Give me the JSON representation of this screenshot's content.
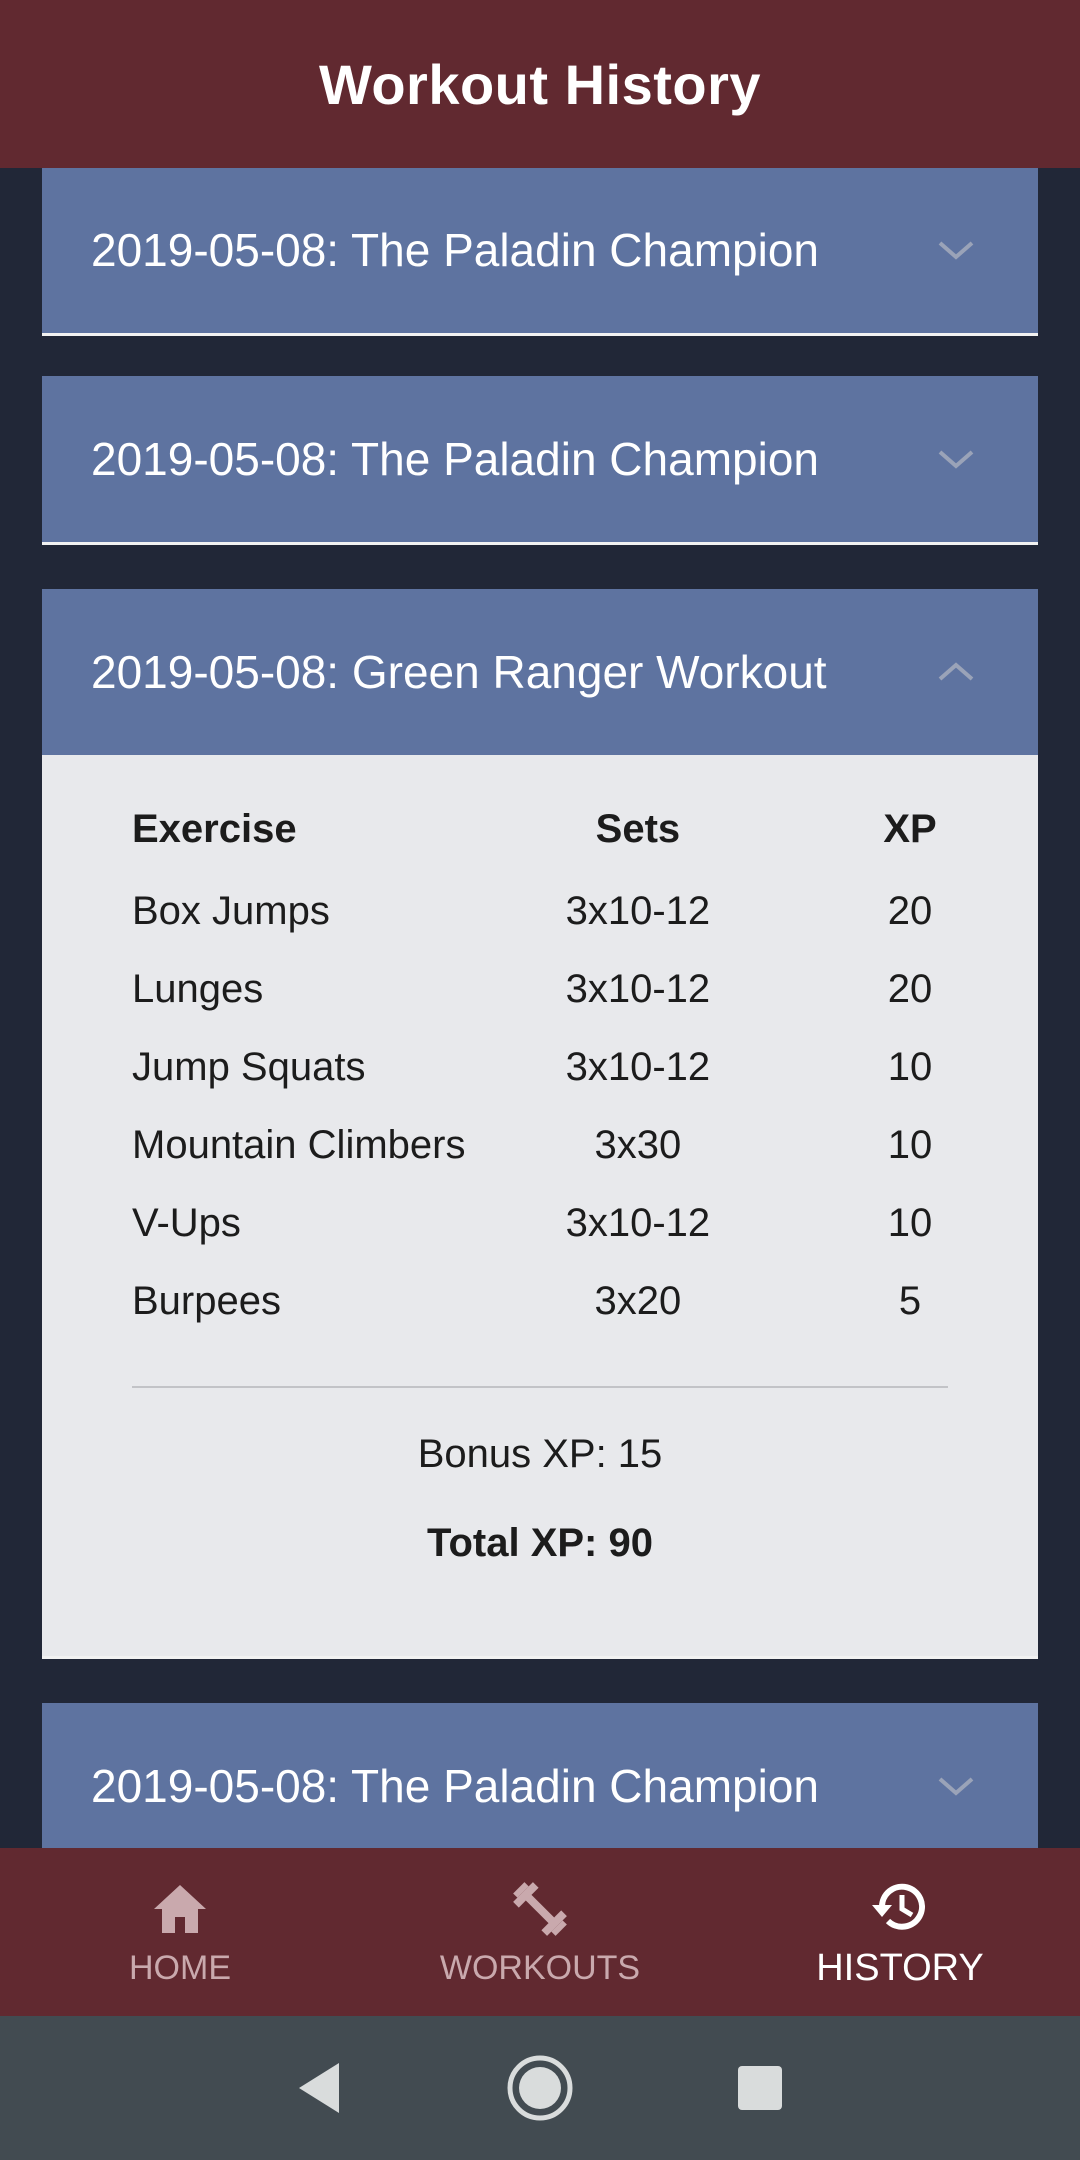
{
  "header": {
    "title": "Workout History"
  },
  "history": {
    "panels": [
      {
        "title": "2019-05-08: The Paladin Champion",
        "expanded": false
      },
      {
        "title": "2019-05-08: The Paladin Champion",
        "expanded": false
      },
      {
        "title": "2019-05-08: Green Ranger Workout",
        "expanded": true,
        "columns": [
          "Exercise",
          "Sets",
          "XP"
        ],
        "rows": [
          {
            "exercise": "Box Jumps",
            "sets": "3x10-12",
            "xp": "20"
          },
          {
            "exercise": "Lunges",
            "sets": "3x10-12",
            "xp": "20"
          },
          {
            "exercise": "Jump Squats",
            "sets": "3x10-12",
            "xp": "10"
          },
          {
            "exercise": "Mountain Climbers",
            "sets": "3x30",
            "xp": "10"
          },
          {
            "exercise": "V-Ups",
            "sets": "3x10-12",
            "xp": "10"
          },
          {
            "exercise": "Burpees",
            "sets": "3x20",
            "xp": "5"
          }
        ],
        "bonus": "Bonus XP: 15",
        "total": "Total XP: 90"
      },
      {
        "title": "2019-05-08: The Paladin Champion",
        "expanded": false
      }
    ]
  },
  "bottom_nav": {
    "items": [
      {
        "label": "HOME",
        "icon": "home-icon",
        "active": false
      },
      {
        "label": "WORKOUTS",
        "icon": "dumbbell-icon",
        "active": false
      },
      {
        "label": "HISTORY",
        "icon": "history-icon",
        "active": true
      }
    ]
  },
  "colors": {
    "app_bar": "#612930",
    "background": "#212737",
    "panel_header": "#5e73a0",
    "panel_body": "#e8e9ec",
    "nav_inactive": "#c9a9ad",
    "nav_active": "#ffffff",
    "system_bar": "#424b51"
  }
}
